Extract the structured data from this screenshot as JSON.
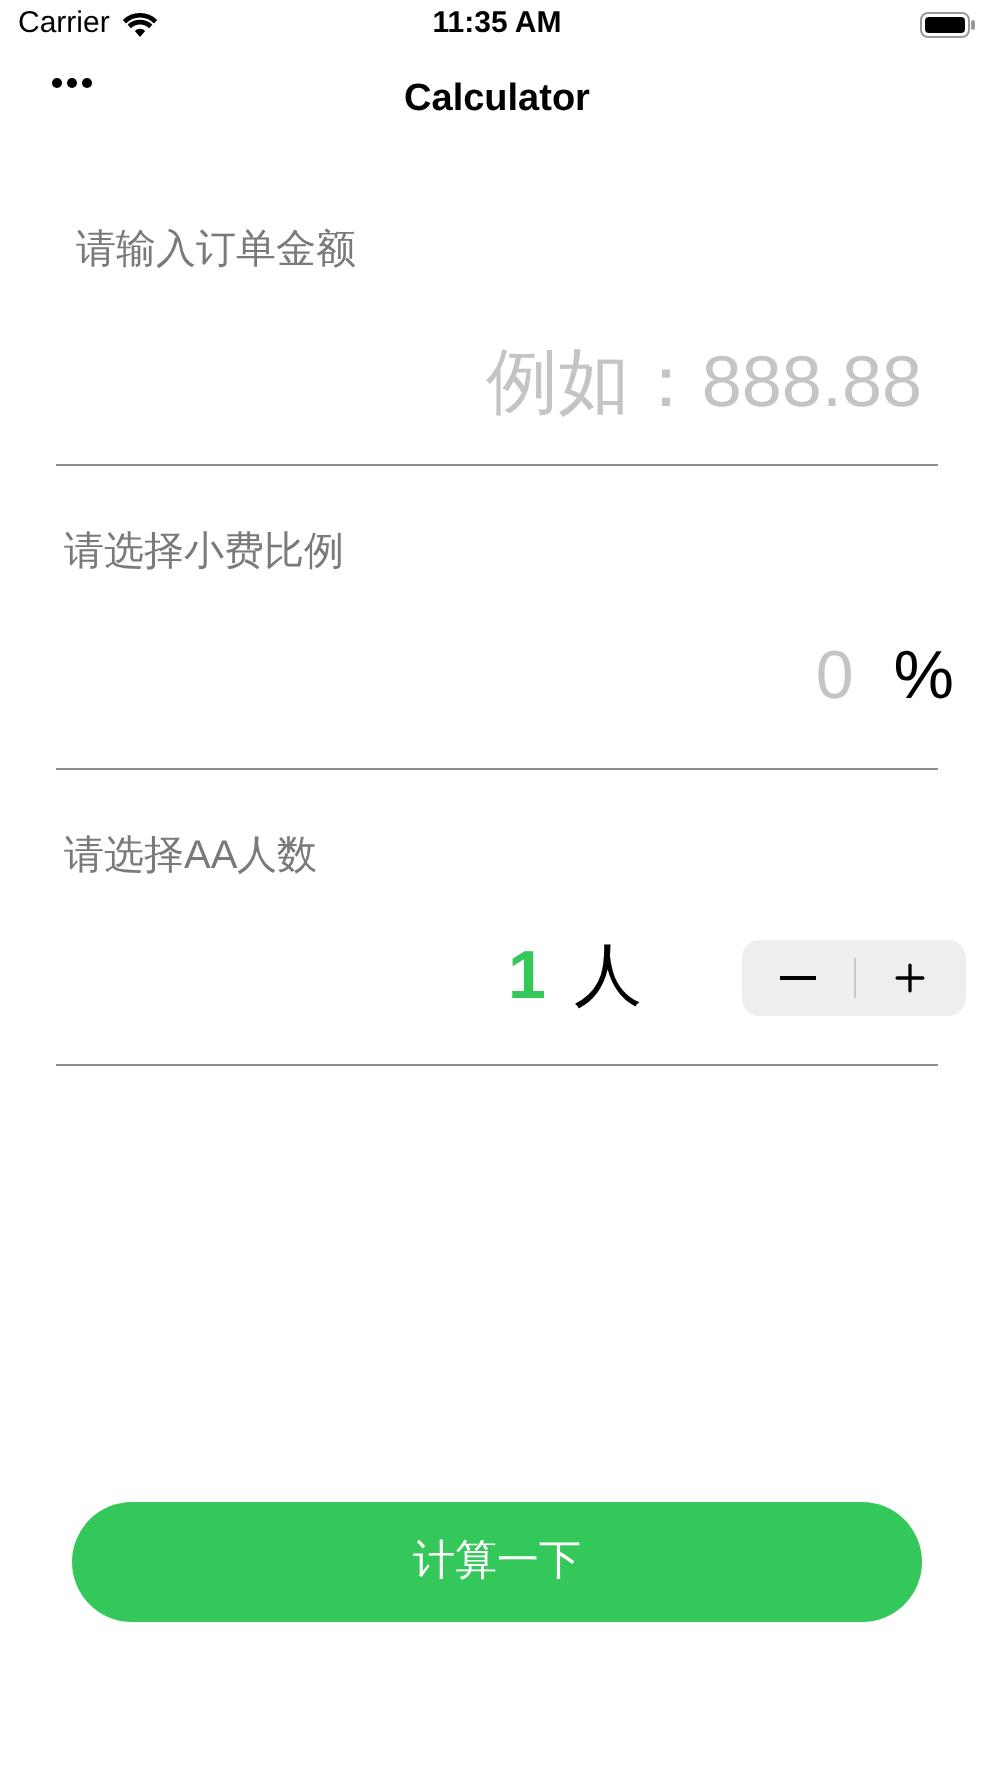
{
  "status_bar": {
    "carrier": "Carrier",
    "time": "11:35 AM"
  },
  "nav": {
    "title": "Calculator"
  },
  "amount": {
    "label": "请输入订单金额",
    "placeholder": "例如：888.88"
  },
  "tip": {
    "label": "请选择小费比例",
    "value": "0",
    "unit": "%"
  },
  "split": {
    "label": "请选择AA人数",
    "count": "1",
    "unit": "人"
  },
  "button": {
    "label": "计算一下"
  }
}
